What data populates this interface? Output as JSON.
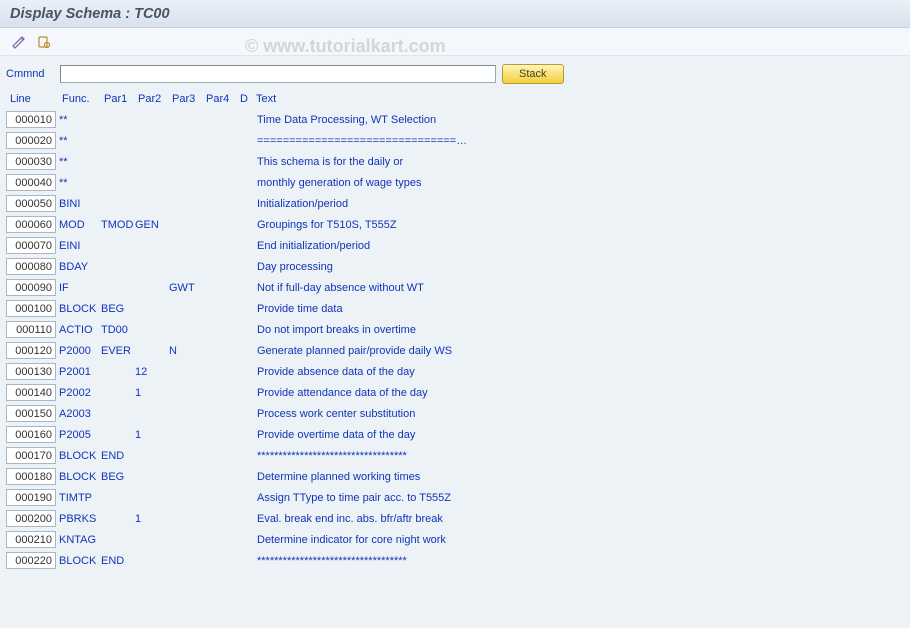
{
  "title": "Display Schema : TC00",
  "watermark": "© www.tutorialkart.com",
  "command": {
    "label": "Cmmnd",
    "value": "",
    "stack_label": "Stack"
  },
  "headers": {
    "line": "Line",
    "func": "Func.",
    "par1": "Par1",
    "par2": "Par2",
    "par3": "Par3",
    "par4": "Par4",
    "d": "D",
    "text": "Text"
  },
  "rows": [
    {
      "line": "000010",
      "func": "**",
      "par1": "",
      "par2": "",
      "par3": "",
      "par4": "",
      "d": "",
      "text": "Time Data Processing, WT Selection"
    },
    {
      "line": "000020",
      "func": "**",
      "par1": "",
      "par2": "",
      "par3": "",
      "par4": "",
      "d": "",
      "text": "===============================…"
    },
    {
      "line": "000030",
      "func": "**",
      "par1": "",
      "par2": "",
      "par3": "",
      "par4": "",
      "d": "",
      "text": "This schema is for the daily or"
    },
    {
      "line": "000040",
      "func": "**",
      "par1": "",
      "par2": "",
      "par3": "",
      "par4": "",
      "d": "",
      "text": "monthly generation of wage types"
    },
    {
      "line": "000050",
      "func": "BINI",
      "par1": "",
      "par2": "",
      "par3": "",
      "par4": "",
      "d": "",
      "text": "Initialization/period"
    },
    {
      "line": "000060",
      "func": "MOD",
      "par1": "TMOD",
      "par2": "GEN",
      "par3": "",
      "par4": "",
      "d": "",
      "text": "Groupings for T510S, T555Z"
    },
    {
      "line": "000070",
      "func": "EINI",
      "par1": "",
      "par2": "",
      "par3": "",
      "par4": "",
      "d": "",
      "text": "End initialization/period"
    },
    {
      "line": "000080",
      "func": "BDAY",
      "par1": "",
      "par2": "",
      "par3": "",
      "par4": "",
      "d": "",
      "text": "Day processing"
    },
    {
      "line": "000090",
      "func": "IF",
      "par1": "",
      "par2": "",
      "par3": "GWT",
      "par4": "",
      "d": "",
      "text": "Not if full-day absence without WT"
    },
    {
      "line": "000100",
      "func": "BLOCK",
      "par1": "BEG",
      "par2": "",
      "par3": "",
      "par4": "",
      "d": "",
      "text": "Provide time data"
    },
    {
      "line": "000110",
      "func": "ACTIO",
      "par1": "TD00",
      "par2": "",
      "par3": "",
      "par4": "",
      "d": "",
      "text": "Do not import breaks in overtime"
    },
    {
      "line": "000120",
      "func": "P2000",
      "par1": "EVER",
      "par2": "",
      "par3": "N",
      "par4": "",
      "d": "",
      "text": "Generate planned pair/provide daily WS"
    },
    {
      "line": "000130",
      "func": "P2001",
      "par1": "",
      "par2": "12",
      "par3": "",
      "par4": "",
      "d": "",
      "text": "Provide absence data of the day"
    },
    {
      "line": "000140",
      "func": "P2002",
      "par1": "",
      "par2": "1",
      "par3": "",
      "par4": "",
      "d": "",
      "text": "Provide attendance data of the day"
    },
    {
      "line": "000150",
      "func": "A2003",
      "par1": "",
      "par2": "",
      "par3": "",
      "par4": "",
      "d": "",
      "text": "Process work center substitution"
    },
    {
      "line": "000160",
      "func": "P2005",
      "par1": "",
      "par2": "1",
      "par3": "",
      "par4": "",
      "d": "",
      "text": "Provide overtime data of the day"
    },
    {
      "line": "000170",
      "func": "BLOCK",
      "par1": "END",
      "par2": "",
      "par3": "",
      "par4": "",
      "d": "",
      "text": "***********************************"
    },
    {
      "line": "000180",
      "func": "BLOCK",
      "par1": "BEG",
      "par2": "",
      "par3": "",
      "par4": "",
      "d": "",
      "text": "Determine planned working times"
    },
    {
      "line": "000190",
      "func": "TIMTP",
      "par1": "",
      "par2": "",
      "par3": "",
      "par4": "",
      "d": "",
      "text": "Assign TType to time pair acc. to T555Z"
    },
    {
      "line": "000200",
      "func": "PBRKS",
      "par1": "",
      "par2": "1",
      "par3": "",
      "par4": "",
      "d": "",
      "text": "Eval. break end inc. abs. bfr/aftr break"
    },
    {
      "line": "000210",
      "func": "KNTAG",
      "par1": "",
      "par2": "",
      "par3": "",
      "par4": "",
      "d": "",
      "text": "Determine indicator for core night work"
    },
    {
      "line": "000220",
      "func": "BLOCK",
      "par1": "END",
      "par2": "",
      "par3": "",
      "par4": "",
      "d": "",
      "text": "***********************************"
    }
  ]
}
